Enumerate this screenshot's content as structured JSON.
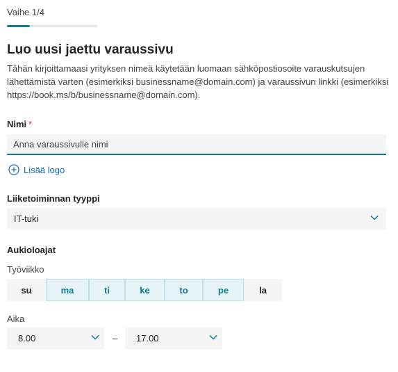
{
  "step": {
    "label": "Vaihe 1/4",
    "progress_fraction": 0.25
  },
  "header": {
    "title": "Luo uusi jaettu varaussivu",
    "description": "Tähän kirjoittamaasi yrityksen nimeä käytetään luomaan sähköpostiosoite varauskutsujen lähettämistä varten (esimerkiksi businessname@domain.com) ja varaussivun linkki (esimerkiksi https://book.ms/b/businessname@domain.com)."
  },
  "name_field": {
    "label": "Nimi",
    "required_mark": "*",
    "placeholder": "Anna varaussivulle nimi",
    "value": ""
  },
  "add_logo": {
    "label": "Lisää logo",
    "icon": "plus-circle-icon"
  },
  "business_type": {
    "label": "Liiketoiminnan tyyppi",
    "selected": "IT-tuki",
    "icon": "chevron-down-icon"
  },
  "hours": {
    "title": "Aukioloajat",
    "workweek_label": "Työviikko",
    "days": [
      {
        "label": "su",
        "selected": false
      },
      {
        "label": "ma",
        "selected": true
      },
      {
        "label": "ti",
        "selected": true
      },
      {
        "label": "ke",
        "selected": true
      },
      {
        "label": "to",
        "selected": true
      },
      {
        "label": "pe",
        "selected": true
      },
      {
        "label": "la",
        "selected": false
      }
    ],
    "time_label": "Aika",
    "start": "8.00",
    "separator": "–",
    "end": "17.00"
  },
  "colors": {
    "accent": "#0f7b8f",
    "link": "#0f6cbd",
    "required": "#c4314b",
    "field_bg": "#f5f5f5",
    "selected_day_bg": "#e6f4f7"
  }
}
